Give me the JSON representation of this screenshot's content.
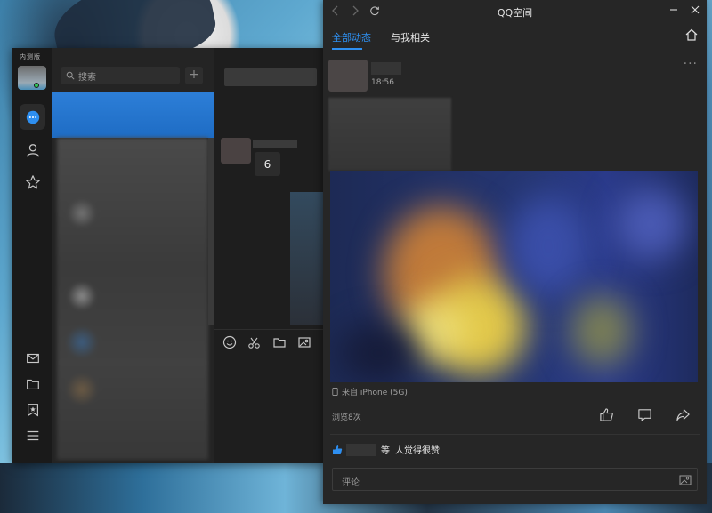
{
  "qq_main": {
    "badge": "内测版",
    "search": {
      "placeholder": "搜索"
    },
    "add_label": "+",
    "chat": {
      "badge_number": "6"
    },
    "rail": {
      "top_icons": [
        "message-icon",
        "contact-icon",
        "star-icon"
      ],
      "bottom_icons": [
        "mail-icon",
        "folder-icon",
        "bookmark-icon",
        "menu-icon"
      ]
    },
    "chat_toolbar_icons": [
      "emoji-icon",
      "scissors-icon",
      "folder-icon",
      "screenshot-icon"
    ]
  },
  "qzone": {
    "title": "QQ空间",
    "tabs": [
      {
        "label": "全部动态",
        "active": true
      },
      {
        "label": "与我相关",
        "active": false
      }
    ],
    "post": {
      "time": "18:56",
      "source": "来自 iPhone (5G)",
      "views": "浏览8次",
      "likes_suffix": "等",
      "likes_text": "人觉得很赞",
      "more": "···"
    },
    "comment": {
      "placeholder": "评论"
    }
  },
  "colors": {
    "accent": "#2e8ff0",
    "selected_row": "#2272cc",
    "panel": "#262626"
  }
}
